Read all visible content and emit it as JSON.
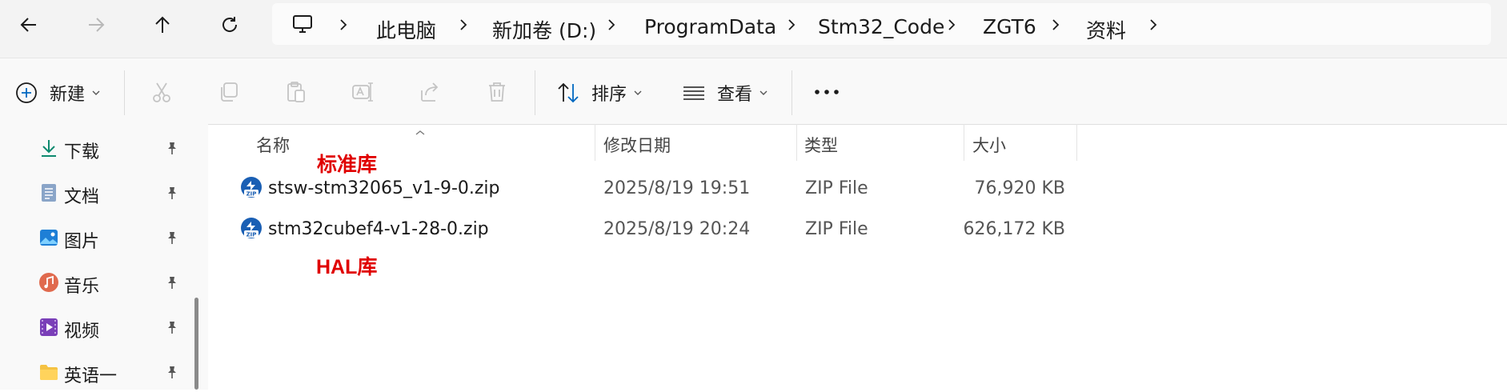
{
  "nav": {
    "back": "back",
    "forward": "forward",
    "up": "up",
    "refresh": "refresh"
  },
  "breadcrumb": [
    "此电脑",
    "新加卷 (D:)",
    "ProgramData",
    "Stm32_Code",
    "ZGT6",
    "资料"
  ],
  "toolbar": {
    "new_label": "新建",
    "sort_label": "排序",
    "view_label": "查看",
    "more_label": "…"
  },
  "sidebar": {
    "items": [
      {
        "label": "下载",
        "icon": "download-icon"
      },
      {
        "label": "文档",
        "icon": "document-icon"
      },
      {
        "label": "图片",
        "icon": "pictures-icon"
      },
      {
        "label": "音乐",
        "icon": "music-icon"
      },
      {
        "label": "视频",
        "icon": "video-icon"
      },
      {
        "label": "英语一",
        "icon": "folder-icon"
      }
    ]
  },
  "columns": {
    "name": "名称",
    "modified": "修改日期",
    "type": "类型",
    "size": "大小"
  },
  "files": [
    {
      "name": "stsw-stm32065_v1-9-0.zip",
      "modified": "2025/8/19 19:51",
      "type": "ZIP File",
      "size": "76,920 KB"
    },
    {
      "name": "stm32cubef4-v1-28-0.zip",
      "modified": "2025/8/19 20:24",
      "type": "ZIP File",
      "size": "626,172 KB"
    }
  ],
  "annotations": {
    "standard": "标准库",
    "hal": "HAL库"
  },
  "colors": {
    "accent": "#0067c0",
    "annotation": "#e00000",
    "icon_gray": "#c4c4c4"
  }
}
